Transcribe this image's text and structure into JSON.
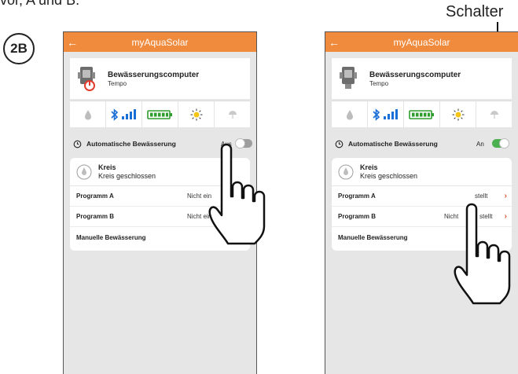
{
  "intro_text": "vor, A und B.",
  "step_badge": "2B",
  "callout": {
    "label": "Schalter"
  },
  "colors": {
    "appbar": "#f08a3c",
    "toggle_on": "#4caf50",
    "toggle_off": "#9e9e9e",
    "accent": "#e0522a",
    "signal": "#1a6fd6",
    "battery": "#2f9e2f"
  },
  "screens": [
    {
      "app_title": "myAquaSolar",
      "back_icon": "back-arrow-icon",
      "device_name": "Bewässerungscomputer",
      "device_model": "Tempo",
      "status_icons": [
        "water-drop-icon",
        "bluetooth-signal-icon",
        "battery-icon",
        "sun-icon",
        "rain-sensor-icon"
      ],
      "auto_label": "Automatische Bewässerung",
      "auto_state": "Aus",
      "toggle_on": false,
      "circuit_title": "Kreis",
      "circuit_status": "Kreis geschlossen",
      "rows": [
        {
          "label": "Programm A",
          "value": "Nicht ein"
        },
        {
          "label": "Programm B",
          "value": "Nicht eing"
        },
        {
          "label": "Manuelle Bewässerung",
          "value": ""
        }
      ]
    },
    {
      "app_title": "myAquaSolar",
      "back_icon": "back-arrow-icon",
      "device_name": "Bewässerungscomputer",
      "device_model": "Tempo",
      "status_icons": [
        "water-drop-icon",
        "bluetooth-signal-icon",
        "battery-icon",
        "sun-icon",
        "rain-sensor-icon"
      ],
      "auto_label": "Automatische Bewässerung",
      "auto_state": "An",
      "toggle_on": true,
      "circuit_title": "Kreis",
      "circuit_status": "Kreis geschlossen",
      "rows": [
        {
          "label": "Programm A",
          "value": "stellt"
        },
        {
          "label": "Programm B",
          "value": "Nicht"
        },
        {
          "label": "Manuelle Bewässerung",
          "value": ""
        }
      ],
      "rows_tail": [
        "",
        "stellt",
        ""
      ]
    }
  ]
}
